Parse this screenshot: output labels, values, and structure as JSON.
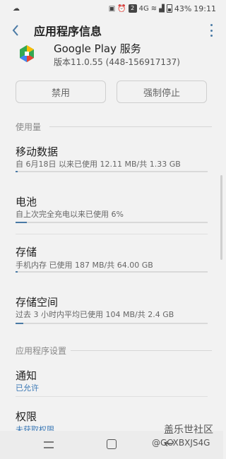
{
  "status_bar": {
    "battery": "43%",
    "time": "19:11",
    "notif_badge": "2",
    "network": "4G"
  },
  "app_bar": {
    "title": "应用程序信息"
  },
  "app_header": {
    "name": "Google Play 服务",
    "version": "版本11.0.55 (448-156917137)"
  },
  "buttons": {
    "disable": "禁用",
    "force_stop": "强制停止"
  },
  "usage_section": {
    "label": "使用量",
    "items": [
      {
        "title": "移动数据",
        "subtitle": "自 6月18日 以来已使用 12.11 MB/共 1.33 GB",
        "progress": 0.01
      },
      {
        "title": "电池",
        "subtitle": "自上次完全充电以来已使用 6%",
        "progress": 0.06
      },
      {
        "title": "存储",
        "subtitle": "手机内存 已使用 187 MB/共 64.00 GB",
        "progress": 0.003
      },
      {
        "title": "存储空间",
        "subtitle": "过去 3 小时内平均已使用 104 MB/共 2.4 GB",
        "progress": 0.04
      }
    ]
  },
  "settings_section": {
    "label": "应用程序设置",
    "items": [
      {
        "title": "通知",
        "subtitle": "已允许"
      },
      {
        "title": "权限",
        "subtitle": "未获取权限"
      }
    ]
  },
  "watermark": {
    "line1": "盖乐世社区",
    "line2": "@GCXBXJS4G"
  },
  "colors": {
    "accent": "#4a7aa5",
    "link": "#3a78b5",
    "background": "#f2f2f2"
  }
}
